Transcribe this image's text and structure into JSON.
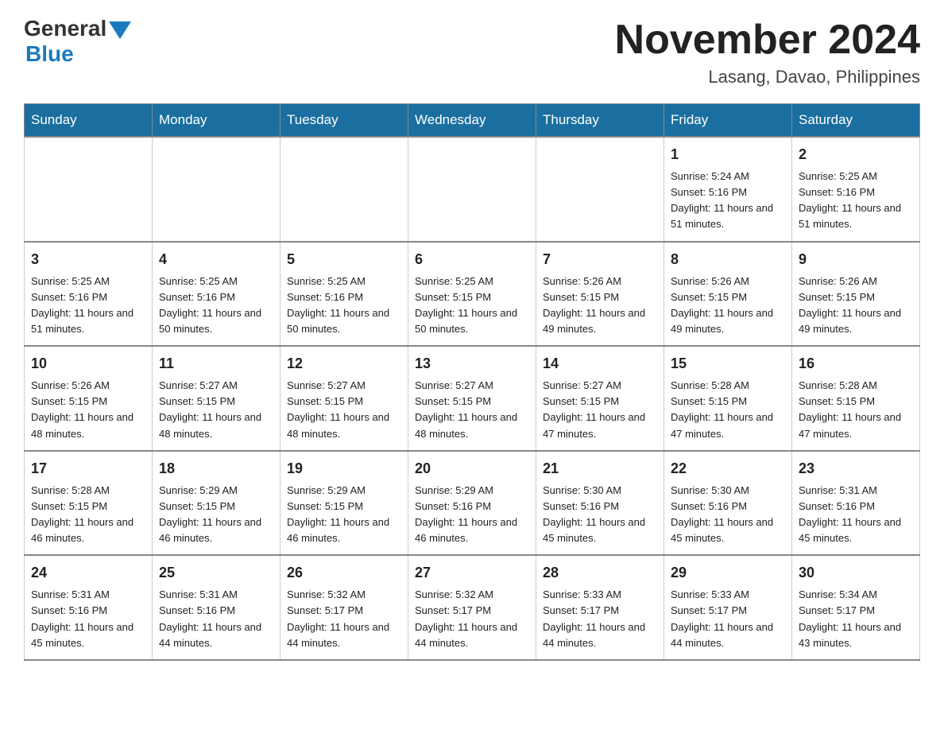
{
  "header": {
    "logo_general": "General",
    "logo_blue": "Blue",
    "month_year": "November 2024",
    "location": "Lasang, Davao, Philippines"
  },
  "weekdays": [
    "Sunday",
    "Monday",
    "Tuesday",
    "Wednesday",
    "Thursday",
    "Friday",
    "Saturday"
  ],
  "weeks": [
    [
      {
        "day": "",
        "info": ""
      },
      {
        "day": "",
        "info": ""
      },
      {
        "day": "",
        "info": ""
      },
      {
        "day": "",
        "info": ""
      },
      {
        "day": "",
        "info": ""
      },
      {
        "day": "1",
        "info": "Sunrise: 5:24 AM\nSunset: 5:16 PM\nDaylight: 11 hours and 51 minutes."
      },
      {
        "day": "2",
        "info": "Sunrise: 5:25 AM\nSunset: 5:16 PM\nDaylight: 11 hours and 51 minutes."
      }
    ],
    [
      {
        "day": "3",
        "info": "Sunrise: 5:25 AM\nSunset: 5:16 PM\nDaylight: 11 hours and 51 minutes."
      },
      {
        "day": "4",
        "info": "Sunrise: 5:25 AM\nSunset: 5:16 PM\nDaylight: 11 hours and 50 minutes."
      },
      {
        "day": "5",
        "info": "Sunrise: 5:25 AM\nSunset: 5:16 PM\nDaylight: 11 hours and 50 minutes."
      },
      {
        "day": "6",
        "info": "Sunrise: 5:25 AM\nSunset: 5:15 PM\nDaylight: 11 hours and 50 minutes."
      },
      {
        "day": "7",
        "info": "Sunrise: 5:26 AM\nSunset: 5:15 PM\nDaylight: 11 hours and 49 minutes."
      },
      {
        "day": "8",
        "info": "Sunrise: 5:26 AM\nSunset: 5:15 PM\nDaylight: 11 hours and 49 minutes."
      },
      {
        "day": "9",
        "info": "Sunrise: 5:26 AM\nSunset: 5:15 PM\nDaylight: 11 hours and 49 minutes."
      }
    ],
    [
      {
        "day": "10",
        "info": "Sunrise: 5:26 AM\nSunset: 5:15 PM\nDaylight: 11 hours and 48 minutes."
      },
      {
        "day": "11",
        "info": "Sunrise: 5:27 AM\nSunset: 5:15 PM\nDaylight: 11 hours and 48 minutes."
      },
      {
        "day": "12",
        "info": "Sunrise: 5:27 AM\nSunset: 5:15 PM\nDaylight: 11 hours and 48 minutes."
      },
      {
        "day": "13",
        "info": "Sunrise: 5:27 AM\nSunset: 5:15 PM\nDaylight: 11 hours and 48 minutes."
      },
      {
        "day": "14",
        "info": "Sunrise: 5:27 AM\nSunset: 5:15 PM\nDaylight: 11 hours and 47 minutes."
      },
      {
        "day": "15",
        "info": "Sunrise: 5:28 AM\nSunset: 5:15 PM\nDaylight: 11 hours and 47 minutes."
      },
      {
        "day": "16",
        "info": "Sunrise: 5:28 AM\nSunset: 5:15 PM\nDaylight: 11 hours and 47 minutes."
      }
    ],
    [
      {
        "day": "17",
        "info": "Sunrise: 5:28 AM\nSunset: 5:15 PM\nDaylight: 11 hours and 46 minutes."
      },
      {
        "day": "18",
        "info": "Sunrise: 5:29 AM\nSunset: 5:15 PM\nDaylight: 11 hours and 46 minutes."
      },
      {
        "day": "19",
        "info": "Sunrise: 5:29 AM\nSunset: 5:15 PM\nDaylight: 11 hours and 46 minutes."
      },
      {
        "day": "20",
        "info": "Sunrise: 5:29 AM\nSunset: 5:16 PM\nDaylight: 11 hours and 46 minutes."
      },
      {
        "day": "21",
        "info": "Sunrise: 5:30 AM\nSunset: 5:16 PM\nDaylight: 11 hours and 45 minutes."
      },
      {
        "day": "22",
        "info": "Sunrise: 5:30 AM\nSunset: 5:16 PM\nDaylight: 11 hours and 45 minutes."
      },
      {
        "day": "23",
        "info": "Sunrise: 5:31 AM\nSunset: 5:16 PM\nDaylight: 11 hours and 45 minutes."
      }
    ],
    [
      {
        "day": "24",
        "info": "Sunrise: 5:31 AM\nSunset: 5:16 PM\nDaylight: 11 hours and 45 minutes."
      },
      {
        "day": "25",
        "info": "Sunrise: 5:31 AM\nSunset: 5:16 PM\nDaylight: 11 hours and 44 minutes."
      },
      {
        "day": "26",
        "info": "Sunrise: 5:32 AM\nSunset: 5:17 PM\nDaylight: 11 hours and 44 minutes."
      },
      {
        "day": "27",
        "info": "Sunrise: 5:32 AM\nSunset: 5:17 PM\nDaylight: 11 hours and 44 minutes."
      },
      {
        "day": "28",
        "info": "Sunrise: 5:33 AM\nSunset: 5:17 PM\nDaylight: 11 hours and 44 minutes."
      },
      {
        "day": "29",
        "info": "Sunrise: 5:33 AM\nSunset: 5:17 PM\nDaylight: 11 hours and 44 minutes."
      },
      {
        "day": "30",
        "info": "Sunrise: 5:34 AM\nSunset: 5:17 PM\nDaylight: 11 hours and 43 minutes."
      }
    ]
  ]
}
